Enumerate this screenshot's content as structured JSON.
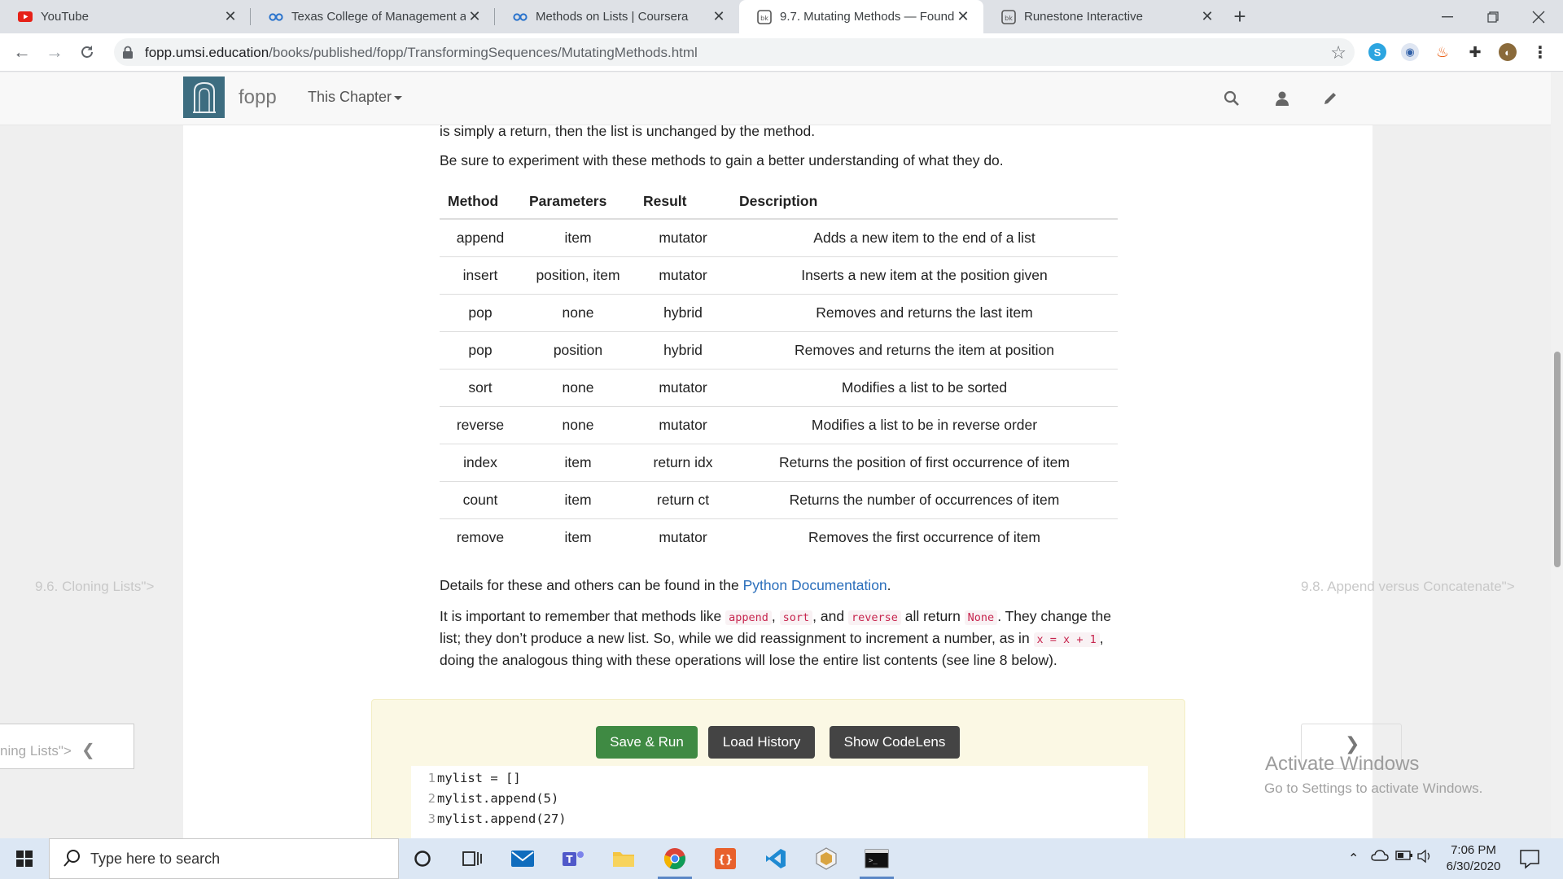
{
  "browser": {
    "tabs": [
      {
        "label": "YouTube",
        "icon": "youtube-icon"
      },
      {
        "label": "Texas College of Management an",
        "icon": "coursera-icon"
      },
      {
        "label": "Methods on Lists | Coursera",
        "icon": "coursera-icon"
      },
      {
        "label": "9.7. Mutating Methods — Found",
        "icon": "runestone-icon",
        "active": true
      },
      {
        "label": "Runestone Interactive",
        "icon": "runestone-icon"
      }
    ],
    "url_host": "fopp.umsi.education",
    "url_path": "/books/published/fopp/TransformingSequences/MutatingMethods.html"
  },
  "site_nav": {
    "brand": "fopp",
    "chapter_menu": "This Chapter"
  },
  "content": {
    "intro_tail": "is simply a return, then the list is unchanged by the method.",
    "experiment": "Be sure to experiment with these methods to gain a better understanding of what they do.",
    "table_headers": [
      "Method",
      "Parameters",
      "Result",
      "Description"
    ],
    "table_rows": [
      [
        "append",
        "item",
        "mutator",
        "Adds a new item to the end of a list"
      ],
      [
        "insert",
        "position, item",
        "mutator",
        "Inserts a new item at the position given"
      ],
      [
        "pop",
        "none",
        "hybrid",
        "Removes and returns the last item"
      ],
      [
        "pop",
        "position",
        "hybrid",
        "Removes and returns the item at position"
      ],
      [
        "sort",
        "none",
        "mutator",
        "Modifies a list to be sorted"
      ],
      [
        "reverse",
        "none",
        "mutator",
        "Modifies a list to be in reverse order"
      ],
      [
        "index",
        "item",
        "return idx",
        "Returns the position of first occurrence of item"
      ],
      [
        "count",
        "item",
        "return ct",
        "Returns the number of occurrences of item"
      ],
      [
        "remove",
        "item",
        "mutator",
        "Removes the first occurrence of item"
      ]
    ],
    "details_prefix": "Details for these and others can be found in the ",
    "details_link": "Python Documentation",
    "details_suffix": ".",
    "important": {
      "p1": "It is important to remember that methods like ",
      "c1": "append",
      "p2": ", ",
      "c2": "sort",
      "p3": ", and ",
      "c3": "reverse",
      "p4": " all return ",
      "c4": "None",
      "p5": ". They change the list; they don’t produce a new list. So, while we did reassignment to increment a number, as in ",
      "c5": "x = x + 1",
      "p6": ", doing the analogous thing with these operations will lose the entire list contents (see line 8 below)."
    }
  },
  "activecode": {
    "save_run": "Save & Run",
    "load_history": "Load History",
    "show_codelens": "Show CodeLens",
    "lines": [
      {
        "num": "1",
        "code": "mylist = []"
      },
      {
        "num": "2",
        "code": "mylist.append(5)"
      },
      {
        "num": "3",
        "code": "mylist.append(27)"
      }
    ]
  },
  "pager": {
    "prev_link": "9.6. Cloning Lists\">",
    "prev_box": "ning Lists\">",
    "prev_arrow": "❮",
    "next_link": "9.8. Append versus Concatenate\">",
    "next_arrow": "❯"
  },
  "watermark": {
    "title": "Activate Windows",
    "subtitle": "Go to Settings to activate Windows."
  },
  "taskbar": {
    "search_placeholder": "Type here to search",
    "time": "7:06 PM",
    "date": "6/30/2020"
  }
}
